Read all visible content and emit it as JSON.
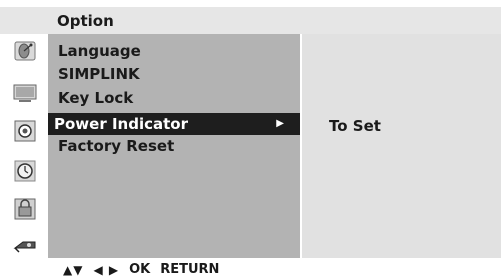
{
  "header": {
    "title": "Option"
  },
  "menu": {
    "items": [
      {
        "label": "Language"
      },
      {
        "label": "SIMPLINK"
      },
      {
        "label": "Key Lock"
      },
      {
        "label": "Power Indicator",
        "selected": true
      },
      {
        "label": "Factory Reset"
      }
    ]
  },
  "submenu": {
    "items": [
      {
        "label": "To Set"
      }
    ]
  },
  "footer": {
    "up_down": "▲▼",
    "left_right": "◀ ▶",
    "ok": "OK",
    "return": "RETURN"
  },
  "icons": [
    "satellite-dish-icon",
    "monitor-icon",
    "speaker-icon",
    "clock-icon",
    "lock-icon",
    "input-icon"
  ]
}
